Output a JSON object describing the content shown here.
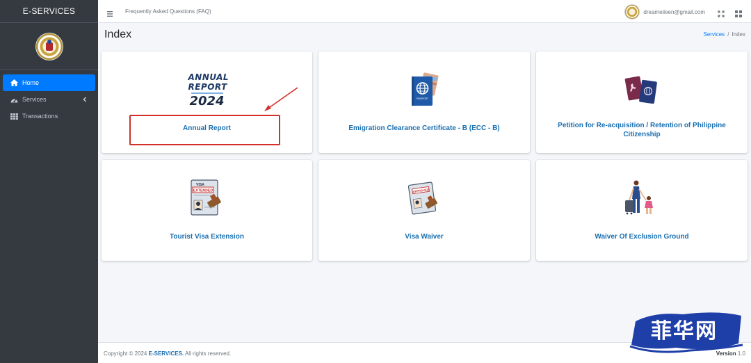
{
  "app": {
    "brand": "E-SERVICES"
  },
  "sidebar": {
    "items": [
      {
        "label": "Home",
        "icon": "home-icon",
        "active": true
      },
      {
        "label": "Services",
        "icon": "dashboard-icon",
        "active": false
      },
      {
        "label": "Transactions",
        "icon": "table-icon",
        "active": false
      }
    ]
  },
  "topbar": {
    "faq_label": "Frequently Asked Questions (FAQ)",
    "user_email": "dreameileen@gmail.com"
  },
  "header": {
    "title": "Index",
    "breadcrumb": {
      "link": "Services",
      "separator": "/",
      "current": "Index"
    }
  },
  "cards": [
    {
      "label": "Annual Report",
      "icon": "annual-report-2024-icon",
      "logo_lines": [
        "ANNUAL",
        "REPORT",
        "2024"
      ]
    },
    {
      "label": "Emigration Clearance Certificate - B (ECC - B)",
      "icon": "passport-icon",
      "passport_text": "PASSPORT"
    },
    {
      "label": "Petition for Re-acquisition / Retention of Philippine Citizenship",
      "icon": "passports-icon"
    },
    {
      "label": "Tourist Visa Extension",
      "icon": "visa-extended-icon",
      "stamp_lines": [
        "VISA",
        "EXTENDED"
      ]
    },
    {
      "label": "Visa Waiver",
      "icon": "approved-stamp-icon",
      "stamp_text": "APPROVED"
    },
    {
      "label": "Waiver Of Exclusion Ground",
      "icon": "traveler-icon"
    }
  ],
  "footer": {
    "copyright_prefix": "Copyright © 2024",
    "copyright_brand": "E-SERVICES.",
    "copyright_suffix": "All rights reserved.",
    "version_label": "Version",
    "version_value": "1.0"
  },
  "watermark": {
    "text": "菲华网"
  },
  "colors": {
    "sidebar": "#343a40",
    "accent": "#007bff",
    "card_title": "#1a6fb0",
    "highlight": "#d4302b",
    "background": "#f4f6f9"
  }
}
